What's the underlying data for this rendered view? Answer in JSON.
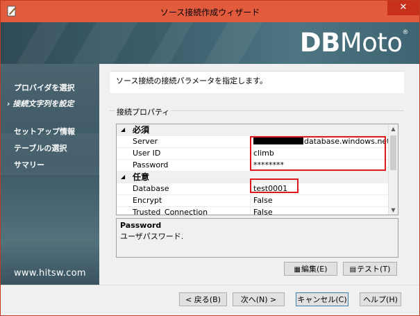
{
  "window": {
    "title": "ソース接続作成ウィザード",
    "close_glyph": "✕"
  },
  "banner": {
    "logo_bold": "DB",
    "logo_light": "Moto",
    "logo_reg": "®"
  },
  "sidebar": {
    "items": [
      {
        "label": "プロバイダを選択",
        "active": false
      },
      {
        "label": "接続文字列を設定",
        "active": true
      },
      {
        "label": "セットアップ情報",
        "active": false
      },
      {
        "label": "テーブルの選択",
        "active": false
      },
      {
        "label": "サマリー",
        "active": false
      }
    ],
    "active_marker": "›",
    "url": "www.hitsw.com"
  },
  "main": {
    "description": "ソース接続の接続パラメータを指定します。",
    "group_label": "接続プロパティ"
  },
  "property_grid": {
    "categories": [
      {
        "label": "必須",
        "rows": [
          {
            "name": "Server",
            "value": "database.windows.net",
            "redacted_prefix": true
          },
          {
            "name": "User ID",
            "value": "climb"
          },
          {
            "name": "Password",
            "value": "********"
          }
        ]
      },
      {
        "label": "任意",
        "rows": [
          {
            "name": "Database",
            "value": "test0001"
          },
          {
            "name": "Encrypt",
            "value": "False"
          },
          {
            "name": "Trusted_Connection",
            "value": "False"
          }
        ]
      }
    ],
    "expanded_glyph": "◢",
    "scroll_up": "▲",
    "scroll_down": "▼"
  },
  "help": {
    "title": "Password",
    "text": "ユーザパスワード."
  },
  "buttons": {
    "edit": "編集(E)",
    "test": "テスト(T)",
    "back": "< 戻る(B)",
    "next": "次へ(N) >",
    "cancel": "キャンセル(C)",
    "help": "ヘルプ(H)"
  },
  "colors": {
    "title_bar": "#e25b3c",
    "highlight_border": "#e0161b",
    "sidebar": "#3d5866"
  }
}
